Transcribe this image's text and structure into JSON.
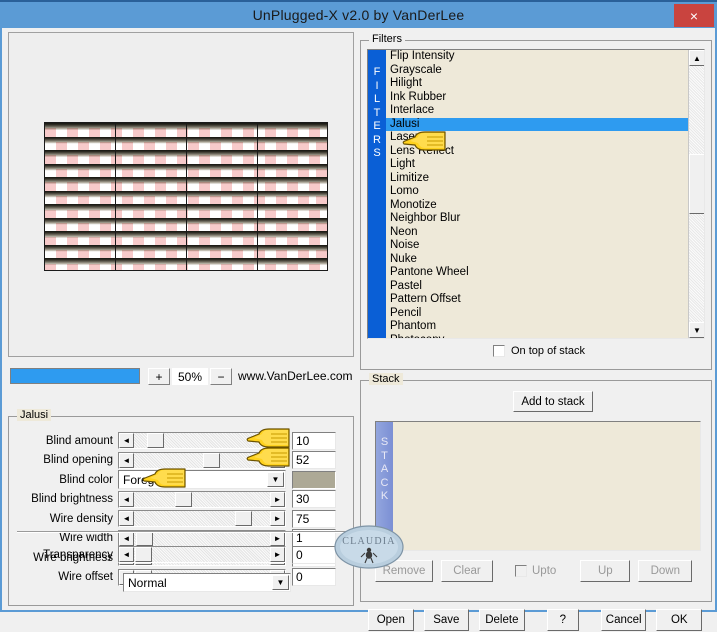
{
  "window": {
    "title": "UnPlugged-X v2.0 by VanDerLee",
    "close_label": "×"
  },
  "zoom_bar": {
    "plus_label": "+",
    "minus_label": "−",
    "value": "50%",
    "url": "www.VanDerLee.com"
  },
  "filters_panel": {
    "group_title": "Filters",
    "sidebar_label": "FILTERS",
    "selected": "Jalusi",
    "items": [
      "Flip Intensity",
      "Grayscale",
      "Hilight",
      "Ink Rubber",
      "Interlace",
      "Jalusi",
      "Laserrays",
      "Lens Reflect",
      "Light",
      "Limitize",
      "Lomo",
      "Monotize",
      "Neighbor Blur",
      "Neon",
      "Noise",
      "Nuke",
      "Pantone Wheel",
      "Pastel",
      "Pattern Offset",
      "Pencil",
      "Phantom",
      "Photocopy"
    ],
    "on_top_label": "On top of stack",
    "scroll_up": "▲",
    "scroll_down": "▼"
  },
  "params_panel": {
    "group_title": "Jalusi",
    "rows": [
      {
        "label": "Blind amount",
        "value": "10",
        "thumb_pct": 9,
        "type": "slider"
      },
      {
        "label": "Blind opening",
        "value": "52",
        "thumb_pct": 51,
        "type": "slider"
      },
      {
        "label": "Blind color",
        "value": "Foreground",
        "type": "combo",
        "swatch": "#ada996"
      },
      {
        "label": "Blind brightness",
        "value": "30",
        "thumb_pct": 30,
        "type": "slider"
      },
      {
        "label": "Wire density",
        "value": "75",
        "thumb_pct": 75,
        "type": "slider"
      },
      {
        "label": "Wire width",
        "value": "1",
        "thumb_pct": 1,
        "type": "slider"
      },
      {
        "label": "Wire brightness",
        "value": "0",
        "thumb_pct": 0,
        "type": "slider"
      },
      {
        "label": "Wire offset",
        "value": "0",
        "thumb_pct": 0,
        "type": "slider"
      }
    ],
    "transparency": {
      "label": "Transparency",
      "value": "0",
      "thumb_pct": 0
    },
    "blend_mode": "Normal",
    "arrow_left": "◄",
    "arrow_right": "►",
    "combo_arrow": "▼"
  },
  "stack_panel": {
    "group_title": "Stack",
    "sidebar_label": "STACK",
    "add_button": "Add to stack",
    "items": [],
    "controls": {
      "remove": "Remove",
      "clear": "Clear",
      "upto": "Upto",
      "up": "Up",
      "down": "Down"
    }
  },
  "bottom_bar": {
    "buttons": [
      "Open",
      "Save",
      "Delete",
      "?",
      "Cancel",
      "OK"
    ]
  },
  "watermark": {
    "text": "CLAUDIA"
  },
  "colors": {
    "titlebar": "#5b9bd5",
    "close": "#c9443f",
    "selection": "#2e9bf0",
    "list_bg": "#eee9d9",
    "filters_sidebar": "#0a5fd6",
    "stack_sidebar": "#7b8fd4",
    "blind_color_swatch": "#ada996"
  }
}
